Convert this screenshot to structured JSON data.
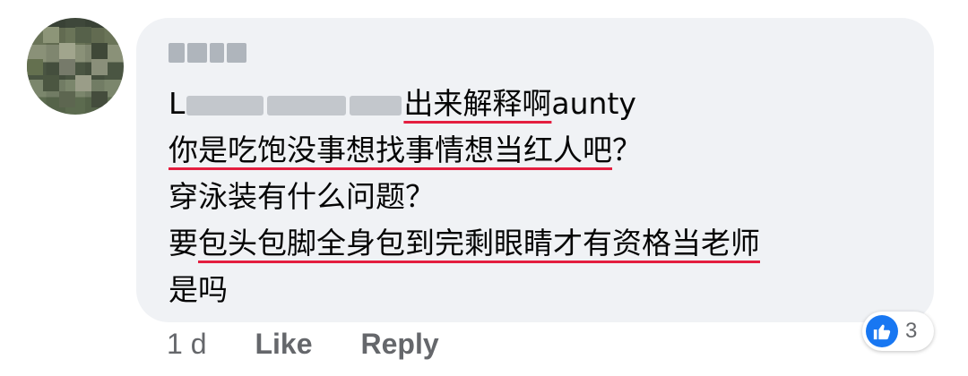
{
  "comment": {
    "author_name": "",
    "lines": [
      {
        "segments": [
          {
            "text": "L",
            "underline": false
          },
          {
            "text": "",
            "mention_blur": true
          },
          {
            "text": "出来解释啊",
            "underline": true
          },
          {
            "text": "aunty",
            "underline": false
          }
        ]
      },
      {
        "segments": [
          {
            "text": "你是吃饱没事想找事情想当红人吧",
            "underline": true
          },
          {
            "text": "？",
            "underline": false
          }
        ]
      },
      {
        "segments": [
          {
            "text": "穿泳装有什么问题？",
            "underline": false
          }
        ]
      },
      {
        "segments": [
          {
            "text": "要",
            "underline": false
          },
          {
            "text": "包头包脚全身包到完剩眼睛才有资格当老师",
            "underline": true
          }
        ]
      },
      {
        "segments": [
          {
            "text": "是吗",
            "underline": false
          }
        ]
      }
    ]
  },
  "actions": {
    "time": "1 d",
    "like_label": "Like",
    "reply_label": "Reply"
  },
  "reactions": {
    "icon": "thumbs-up-icon",
    "count": "3",
    "color": "#1877f2"
  },
  "colors": {
    "bubble": "#f0f2f5",
    "underline": "#e41e3f",
    "meta_text": "#65676b"
  }
}
